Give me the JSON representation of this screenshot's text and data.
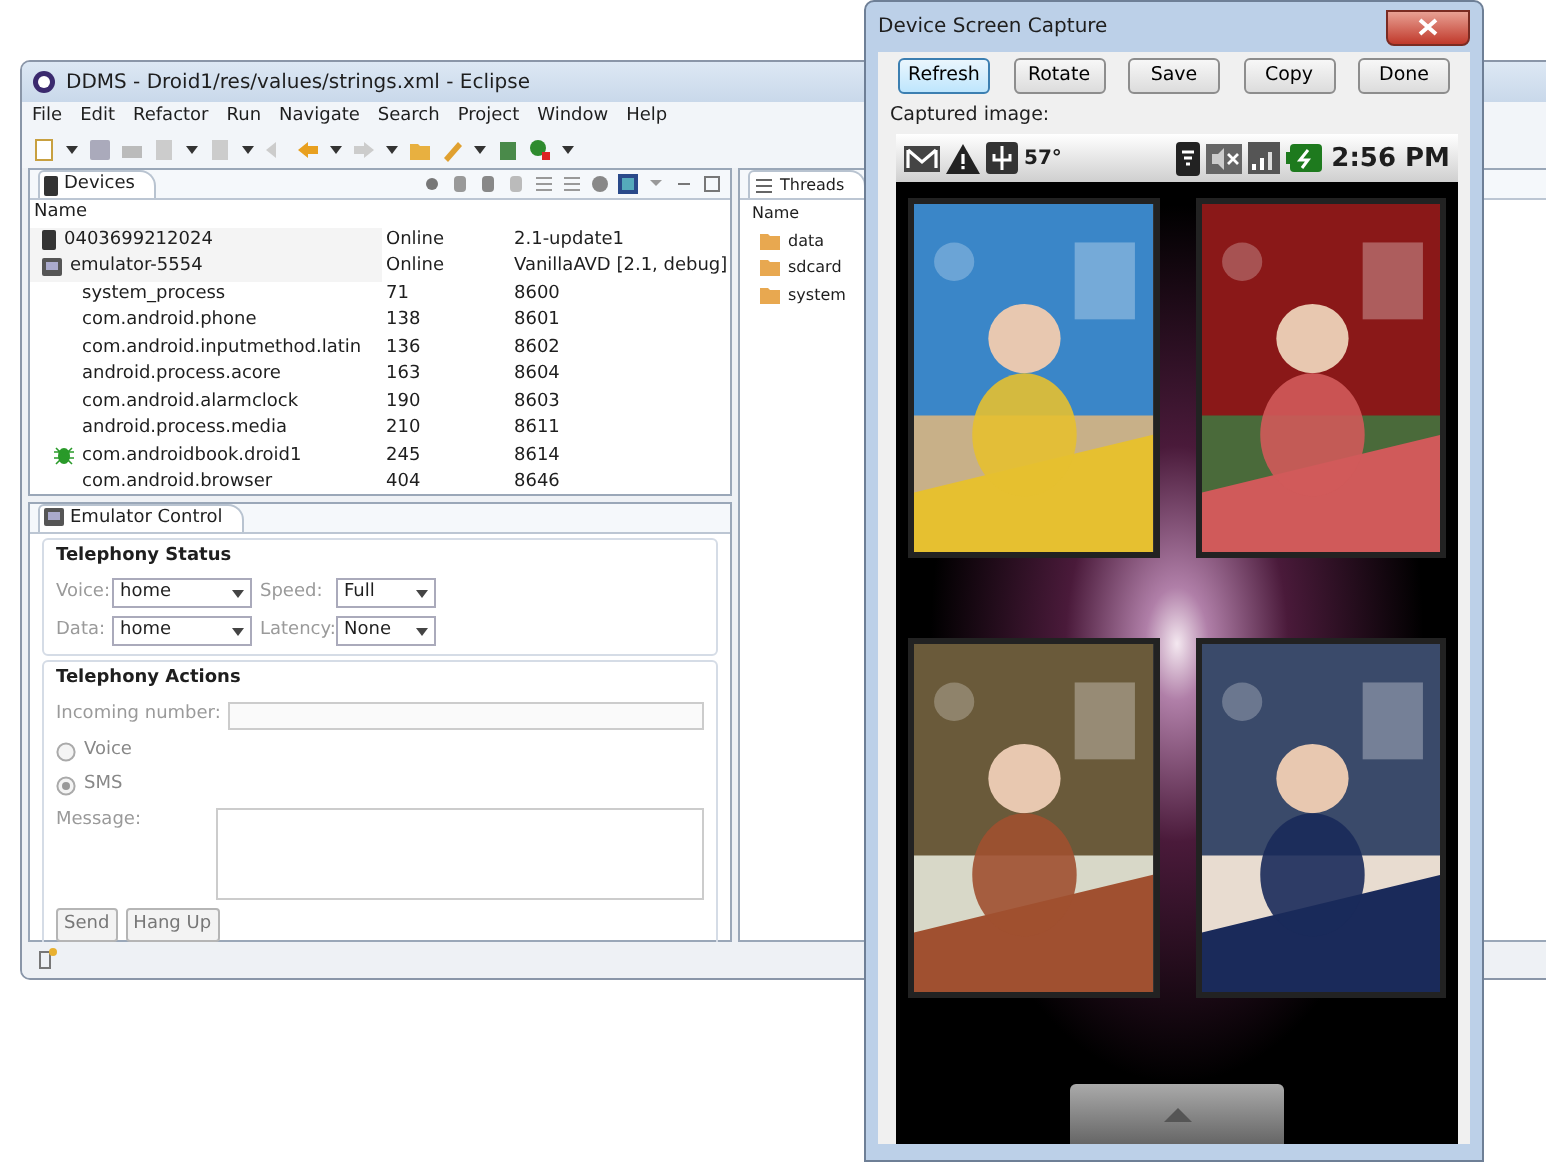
{
  "eclipse_window": {
    "title": "DDMS - Droid1/res/values/strings.xml - Eclipse",
    "menu": [
      "File",
      "Edit",
      "Refactor",
      "Run",
      "Navigate",
      "Search",
      "Project",
      "Window",
      "Help"
    ]
  },
  "devices_panel": {
    "tab": "Devices",
    "columns": [
      "Name"
    ],
    "rows": [
      {
        "kind": "device",
        "name": "0403699212024",
        "column_2": "Online",
        "column_3": "2.1-update1"
      },
      {
        "kind": "emulator",
        "name": "emulator-5554",
        "column_2": "Online",
        "column_3": "VanillaAVD [2.1, debug]"
      },
      {
        "kind": "process",
        "name": "system_process",
        "column_2": "71",
        "column_3": "8600"
      },
      {
        "kind": "process",
        "name": "com.android.phone",
        "column_2": "138",
        "column_3": "8601"
      },
      {
        "kind": "process",
        "name": "com.android.inputmethod.latin",
        "column_2": "136",
        "column_3": "8602"
      },
      {
        "kind": "process",
        "name": "android.process.acore",
        "column_2": "163",
        "column_3": "8604"
      },
      {
        "kind": "process",
        "name": "com.android.alarmclock",
        "column_2": "190",
        "column_3": "8603"
      },
      {
        "kind": "process",
        "name": "android.process.media",
        "column_2": "210",
        "column_3": "8611"
      },
      {
        "kind": "debug",
        "name": "com.androidbook.droid1",
        "column_2": "245",
        "column_3": "8614"
      },
      {
        "kind": "process",
        "name": "com.android.browser",
        "column_2": "404",
        "column_3": "8646"
      }
    ]
  },
  "emulator_control": {
    "tab": "Emulator Control",
    "telephony_status": {
      "legend": "Telephony Status",
      "fields": [
        {
          "label": "Voice:",
          "value": "home",
          "label_2": "Speed:",
          "value_2": "Full"
        },
        {
          "label": "Data:",
          "value": "home",
          "label_2": "Latency:",
          "value_2": "None"
        }
      ]
    },
    "telephony_actions": {
      "legend": "Telephony Actions",
      "incoming_number_label": "Incoming number:",
      "radios": [
        {
          "label": "Voice",
          "selected": false
        },
        {
          "label": "SMS",
          "selected": true
        }
      ],
      "message_label": "Message:",
      "buttons": [
        "Send",
        "Hang Up"
      ]
    }
  },
  "file_panel": {
    "tab": "Threads",
    "columns": [
      "Name"
    ],
    "items": [
      "data",
      "sdcard",
      "system"
    ]
  },
  "capture_window": {
    "title": "Device Screen Capture",
    "buttons": [
      {
        "label": "Refresh",
        "focused": true
      },
      {
        "label": "Rotate",
        "focused": false
      },
      {
        "label": "Save",
        "focused": false
      },
      {
        "label": "Copy",
        "focused": false
      },
      {
        "label": "Done",
        "focused": false
      }
    ],
    "caption": "Captured image:",
    "phone": {
      "temperature": "57°",
      "time": "2:56 PM"
    }
  }
}
